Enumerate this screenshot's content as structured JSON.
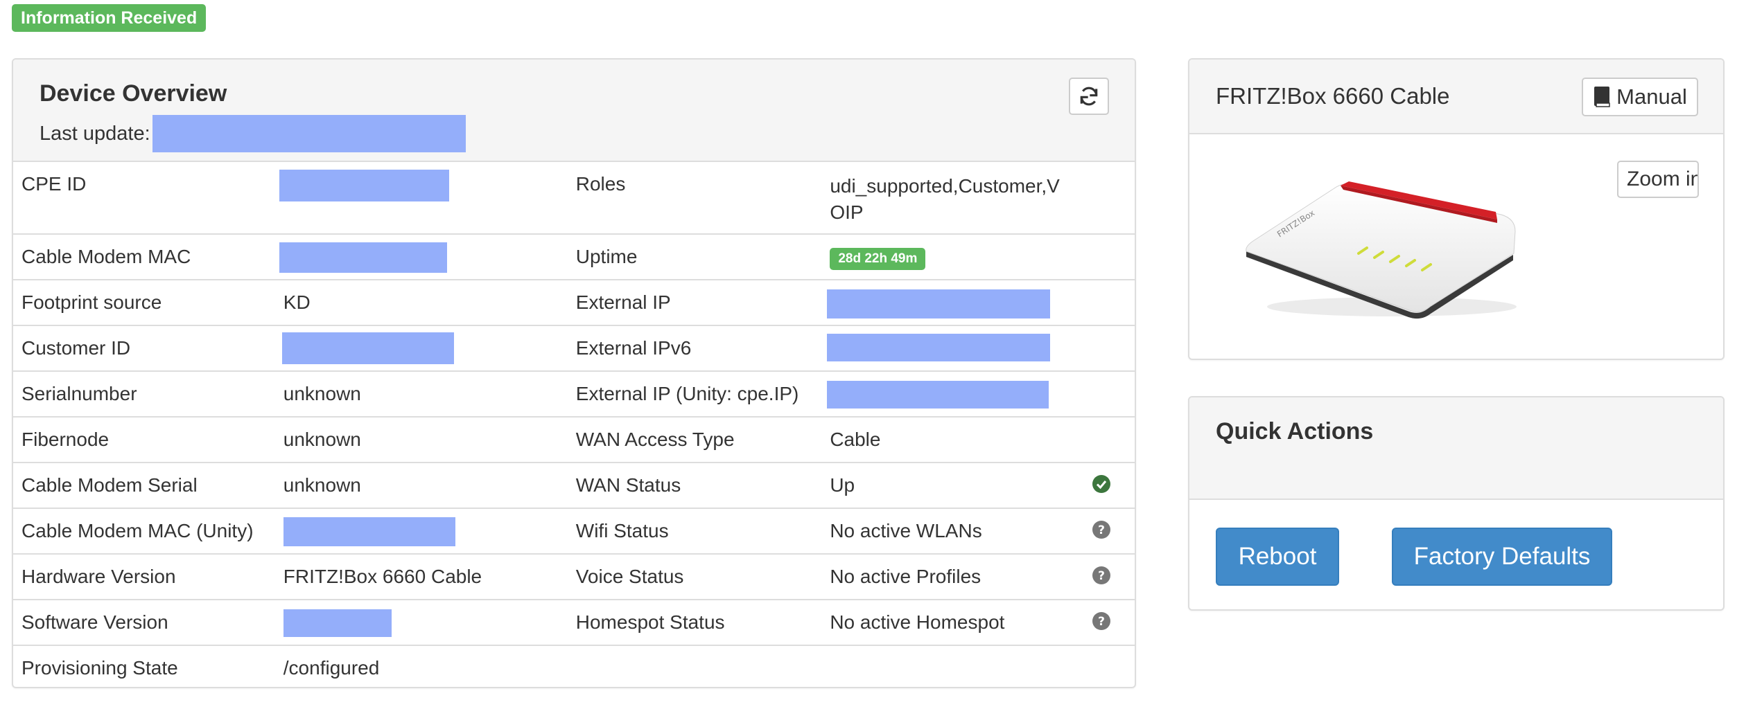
{
  "status_badge": "Information Received",
  "overview": {
    "title": "Device Overview",
    "last_update_label": "Last update:",
    "rows": [
      {
        "label1": "CPE ID",
        "value1": "",
        "label2": "Roles",
        "value2": "udi_supported,Customer,VOIP",
        "icon": ""
      },
      {
        "label1": "Cable Modem MAC",
        "value1": "",
        "label2": "Uptime",
        "value2": "28d 22h 49m",
        "icon": ""
      },
      {
        "label1": "Footprint source",
        "value1": "KD",
        "label2": "External IP",
        "value2": "",
        "icon": ""
      },
      {
        "label1": "Customer ID",
        "value1": "",
        "label2": "External IPv6",
        "value2": "",
        "icon": ""
      },
      {
        "label1": "Serialnumber",
        "value1": "unknown",
        "label2": "External IP (Unity: cpe.IP)",
        "value2": "",
        "icon": ""
      },
      {
        "label1": "Fibernode",
        "value1": "unknown",
        "label2": "WAN Access Type",
        "value2": "Cable",
        "icon": ""
      },
      {
        "label1": "Cable Modem Serial",
        "value1": "unknown",
        "label2": "WAN Status",
        "value2": "Up",
        "icon": "check-circle-icon"
      },
      {
        "label1": "Cable Modem MAC (Unity)",
        "value1": "",
        "label2": "Wifi Status",
        "value2": "No active WLANs",
        "icon": "question-circle-icon"
      },
      {
        "label1": "Hardware Version",
        "value1": "FRITZ!Box 6660 Cable",
        "label2": "Voice Status",
        "value2": "No active Profiles",
        "icon": "question-circle-icon"
      },
      {
        "label1": "Software Version",
        "value1": "",
        "label2": "Homespot Status",
        "value2": "No active Homespot",
        "icon": "question-circle-icon"
      },
      {
        "label1": "Provisioning State",
        "value1": "/configured",
        "label2": "",
        "value2": "",
        "icon": ""
      }
    ]
  },
  "device": {
    "title": "FRITZ!Box 6660 Cable",
    "manual_label": "Manual",
    "zoom_label": "Zoom in",
    "brand_text": "FRITZ!Box"
  },
  "quick_actions": {
    "title": "Quick Actions",
    "reboot_label": "Reboot",
    "factory_label": "Factory Defaults"
  },
  "colors": {
    "success": "#5cb85c",
    "primary": "#428bca",
    "redacted": "#94aefa",
    "status_ok": "#3c763d",
    "status_unknown": "#777777"
  }
}
